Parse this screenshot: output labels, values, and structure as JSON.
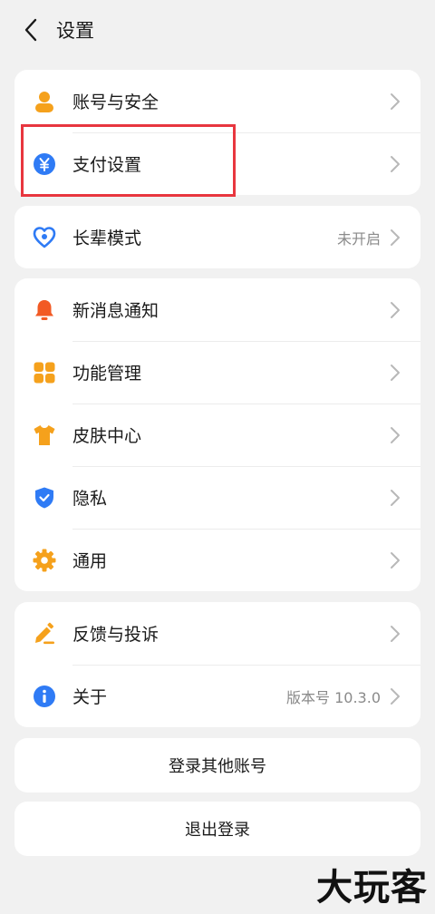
{
  "header": {
    "title": "设置",
    "back_icon": "chevron-left-icon"
  },
  "groups": [
    {
      "items": [
        {
          "label": "账号与安全",
          "icon": "user-icon",
          "color": "#f5a11c"
        },
        {
          "label": "支付设置",
          "icon": "yuan-icon",
          "color": "#2f7bf5"
        }
      ]
    },
    {
      "items": [
        {
          "label": "长辈模式",
          "icon": "heart-icon",
          "color": "#2f7bf5",
          "value": "未开启"
        }
      ]
    },
    {
      "items": [
        {
          "label": "新消息通知",
          "icon": "bell-icon",
          "color": "#f25a24"
        },
        {
          "label": "功能管理",
          "icon": "grid-icon",
          "color": "#f5a11c"
        },
        {
          "label": "皮肤中心",
          "icon": "tshirt-icon",
          "color": "#f5a11c"
        },
        {
          "label": "隐私",
          "icon": "shield-icon",
          "color": "#2f7bf5"
        },
        {
          "label": "通用",
          "icon": "gear-icon",
          "color": "#f5a11c"
        }
      ]
    },
    {
      "items": [
        {
          "label": "反馈与投诉",
          "icon": "pen-icon",
          "color": "#f5a11c"
        },
        {
          "label": "关于",
          "icon": "info-icon",
          "color": "#2f7bf5",
          "value": "版本号 10.3.0"
        }
      ]
    }
  ],
  "buttons": {
    "switch_account": "登录其他账号",
    "logout": "退出登录"
  },
  "watermark": "大玩客"
}
